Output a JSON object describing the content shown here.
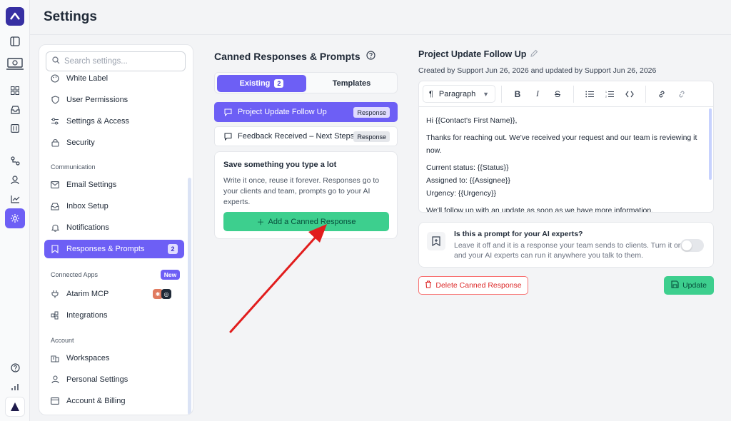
{
  "header": {
    "title": "Settings"
  },
  "rail": {
    "icons": [
      "logo-icon",
      "panel-toggle-icon",
      "team-computer-icon",
      "grid-icon",
      "inbox-icon",
      "calendar-icon",
      "workflow-icon",
      "user-icon",
      "analytics-icon",
      "settings-icon",
      "help-icon",
      "stats-icon",
      "atarim-logo-icon"
    ]
  },
  "sidebar": {
    "search_placeholder": "Search settings...",
    "items_top": [
      {
        "label": "White Label",
        "icon": "palette-icon"
      },
      {
        "label": "User Permissions",
        "icon": "shield-icon"
      },
      {
        "label": "Settings & Access",
        "icon": "sliders-icon"
      },
      {
        "label": "Security",
        "icon": "lock-icon"
      }
    ],
    "section_communication": "Communication",
    "items_comm": [
      {
        "label": "Email Settings",
        "icon": "mail-icon"
      },
      {
        "label": "Inbox Setup",
        "icon": "inbox-icon"
      },
      {
        "label": "Notifications",
        "icon": "bell-icon"
      },
      {
        "label": "Responses & Prompts",
        "icon": "bookmark-icon",
        "count": "2"
      }
    ],
    "section_connected": "Connected Apps",
    "new_badge": "New",
    "items_connected": [
      {
        "label": "Atarim MCP",
        "icon": "plug-icon"
      },
      {
        "label": "Integrations",
        "icon": "puzzle-icon"
      }
    ],
    "section_account": "Account",
    "items_account": [
      {
        "label": "Workspaces",
        "icon": "building-icon"
      },
      {
        "label": "Personal Settings",
        "icon": "person-icon"
      },
      {
        "label": "Account & Billing",
        "icon": "card-icon"
      }
    ]
  },
  "middle": {
    "title": "Canned Responses & Prompts",
    "tabs": [
      {
        "label": "Existing",
        "count": "2"
      },
      {
        "label": "Templates"
      }
    ],
    "responses": [
      {
        "label": "Project Update Follow Up",
        "tag": "Response"
      },
      {
        "label": "Feedback Received – Next Steps",
        "tag": "Response"
      }
    ],
    "save_card": {
      "title": "Save something you type a lot",
      "text": "Write it once, reuse it forever. Responses go to your clients and team, prompts go to your AI experts.",
      "button": "Add a Canned Response"
    }
  },
  "detail": {
    "title": "Project Update Follow Up",
    "meta": "Created by Support Jun 26, 2026 and updated by Support Jun 26, 2026",
    "toolbar": {
      "paragraph": "Paragraph"
    },
    "body": {
      "line1": "Hi {{Contact's First Name}},",
      "line2": "Thanks for reaching out. We've received your request and our team is reviewing it now.",
      "line3": "Current status: {{Status}}",
      "line4": "Assigned to: {{Assignee}}",
      "line5": "Urgency: {{Urgency}}",
      "line6": "We'll follow up with an update as soon as we have more information."
    },
    "prompt": {
      "question": "Is this a prompt for your AI experts?",
      "description": "Leave it off and it is a response your team sends to clients. Turn it on and your AI experts can run it anywhere you talk to them.",
      "enabled": false
    },
    "delete_button": "Delete Canned Response",
    "update_button": "Update"
  },
  "colors": {
    "accent": "#6d5ff5",
    "success": "#3dcf8e",
    "danger": "#dc2626",
    "annotation_arrow": "#e11d1d"
  }
}
